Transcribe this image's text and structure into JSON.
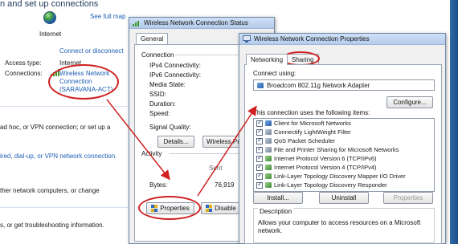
{
  "background": {
    "title": "n and set up connections",
    "see_full_map": "See full map",
    "internet": "Internet",
    "connect_disconnect": "Connect or disconnect",
    "access_type_label": "Access type:",
    "access_type_value": "Internet",
    "connections_label": "Connections:",
    "connection_link_1": "Wireless Network",
    "connection_link_2": "Connection",
    "connection_link_3": "(SARAVANA-ACT)",
    "task_1": "ad hoc, or VPN connection; or set up a",
    "task_2": "ired, dial-up, or VPN network connection.",
    "task_3": "ther network computers, or change",
    "task_4": "s, or get troubleshooting information."
  },
  "status_dialog": {
    "title": "Wireless Network Connection Status",
    "tab_general": "General",
    "connection_heading": "Connection",
    "ipv4": "IPv4 Connectivity:",
    "ipv6": "IPv6 Connectivity:",
    "media_state": "Media State:",
    "ssid": "SSID:",
    "duration": "Duration:",
    "speed": "Speed:",
    "signal_quality": "Signal Quality:",
    "details_button": "Details...",
    "wireless_button": "Wireless Pro",
    "activity_heading": "Activity",
    "sent": "Sent",
    "bytes_label": "Bytes:",
    "bytes_value": "76,919",
    "properties_button": "Properties",
    "disable_button": "Disable"
  },
  "properties_dialog": {
    "title": "Wireless Network Connection Properties",
    "tab_networking": "Networking",
    "tab_sharing": "Sharing",
    "connect_using": "Connect using:",
    "adapter": "Broadcom 802.11g Network Adapter",
    "configure_button": "Configure...",
    "items_heading": "This connection uses the following items:",
    "items": [
      {
        "label": "Client for Microsoft Networks",
        "icon": "network-client-icon"
      },
      {
        "label": "Connectify LightWeight Filter",
        "icon": "service-icon"
      },
      {
        "label": "QoS Packet Scheduler",
        "icon": "service-icon"
      },
      {
        "label": "File and Printer Sharing for Microsoft Networks",
        "icon": "service-icon"
      },
      {
        "label": "Internet Protocol Version 6 (TCP/IPv6)",
        "icon": "protocol-icon"
      },
      {
        "label": "Internet Protocol Version 4 (TCP/IPv4)",
        "icon": "protocol-icon"
      },
      {
        "label": "Link-Layer Topology Discovery Mapper I/O Driver",
        "icon": "protocol-icon"
      },
      {
        "label": "Link-Layer Topology Discovery Responder",
        "icon": "protocol-icon"
      }
    ],
    "install_button": "Install...",
    "uninstall_button": "Uninstall",
    "properties_button": "Properties",
    "description_heading": "Description",
    "description_text_1": "Allows your computer to access resources on a Microsoft",
    "description_text_2": "network."
  },
  "colors": {
    "annotation": "#d02020",
    "link": "#1e5fb4",
    "titlebar": "#c2d6f0"
  }
}
